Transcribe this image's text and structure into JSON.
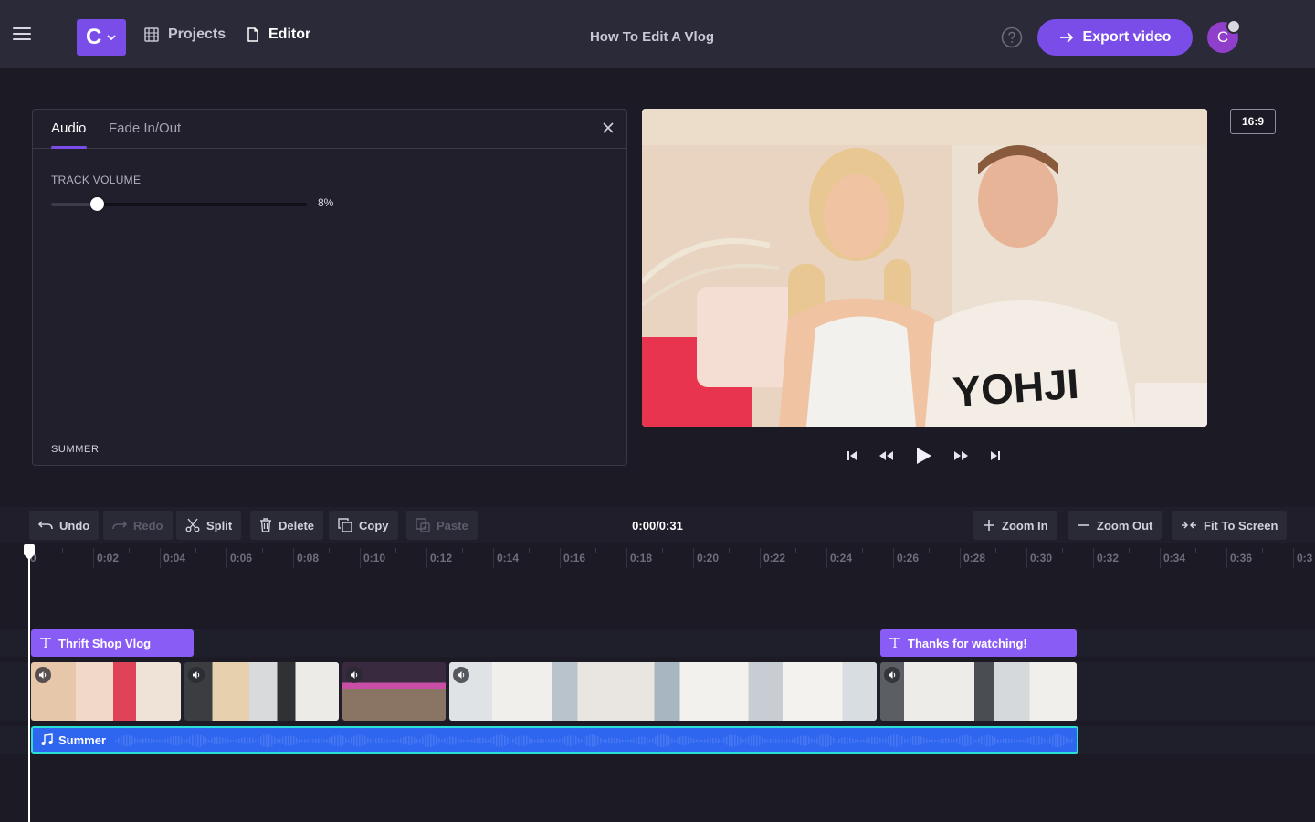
{
  "header": {
    "logo_letter": "C",
    "nav": {
      "projects": "Projects",
      "editor": "Editor"
    },
    "doc_title": "How To Edit A Vlog",
    "export_label": "Export video",
    "avatar_letter": "C"
  },
  "panel": {
    "tabs": [
      "Audio",
      "Fade In/Out"
    ],
    "active_tab": "Audio",
    "volume_label": "TRACK VOLUME",
    "volume_value": "8%",
    "volume_fraction": 0.08,
    "track_name": "SUMMER"
  },
  "preview": {
    "aspect_label": "16:9"
  },
  "toolbar": {
    "undo": "Undo",
    "redo": "Redo",
    "split": "Split",
    "delete": "Delete",
    "copy": "Copy",
    "paste": "Paste",
    "timecode": "0:00/0:31",
    "zoom_in": "Zoom In",
    "zoom_out": "Zoom Out",
    "fit": "Fit To Screen"
  },
  "ruler": {
    "labels": [
      "0",
      "0:02",
      "0:04",
      "0:06",
      "0:08",
      "0:10",
      "0:12",
      "0:14",
      "0:16",
      "0:18",
      "0:20",
      "0:22",
      "0:24",
      "0:26",
      "0:28",
      "0:30",
      "0:32",
      "0:34",
      "0:36",
      "0:3"
    ]
  },
  "timeline": {
    "text_clips": [
      "Thrift Shop Vlog",
      "Thanks for watching!"
    ],
    "audio_clip": "Summer",
    "accent": "#8a5cf6",
    "audio_color": "#2f66f0"
  }
}
